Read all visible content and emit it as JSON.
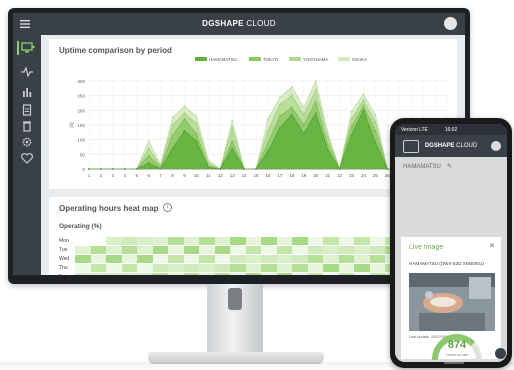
{
  "app": {
    "title_bold": "DGSHAPE",
    "title_rest": " CLOUD"
  },
  "sidebar": {
    "items": [
      "monitor-icon",
      "pulse-icon",
      "bar-chart-icon",
      "clipboard-icon",
      "trash-icon",
      "gear-icon",
      "heart-icon"
    ]
  },
  "uptime": {
    "title": "Uptime comparison by period",
    "ylabel": "[h]",
    "yticks": [
      "0",
      "50",
      "100",
      "150",
      "200",
      "250",
      "300"
    ],
    "xticks": [
      "1",
      "2",
      "3",
      "4",
      "5",
      "6",
      "7",
      "8",
      "9",
      "10",
      "11",
      "12",
      "13",
      "14",
      "15",
      "16",
      "17",
      "18",
      "19",
      "20",
      "21",
      "22",
      "23",
      "24",
      "25",
      "26",
      "27",
      "28",
      "29",
      "30",
      "31"
    ],
    "legend": [
      "HAMAMATSU",
      "TOKYO",
      "YOKOHAMA",
      "OSAKA"
    ]
  },
  "chart_data": {
    "type": "area",
    "x": [
      1,
      2,
      3,
      4,
      5,
      6,
      7,
      8,
      9,
      10,
      11,
      12,
      13,
      14,
      15,
      16,
      17,
      18,
      19,
      20,
      21,
      22,
      23,
      24,
      25,
      26,
      27,
      28,
      29,
      30,
      31
    ],
    "ylim": [
      0,
      300
    ],
    "ylabel": "[h]",
    "series": [
      {
        "name": "HAMAMATSU",
        "values": [
          0,
          0,
          0,
          0,
          0,
          20,
          0,
          70,
          130,
          95,
          5,
          0,
          70,
          0,
          0,
          60,
          140,
          185,
          120,
          190,
          65,
          0,
          115,
          200,
          90,
          0,
          0,
          0,
          0,
          0,
          0
        ]
      },
      {
        "name": "TOKYO",
        "values": [
          0,
          0,
          0,
          0,
          0,
          45,
          5,
          115,
          170,
          120,
          10,
          0,
          95,
          0,
          0,
          90,
          180,
          210,
          150,
          230,
          85,
          0,
          145,
          215,
          130,
          0,
          0,
          0,
          0,
          0,
          0
        ]
      },
      {
        "name": "YOKOHAMA",
        "values": [
          0,
          0,
          0,
          0,
          0,
          70,
          10,
          150,
          190,
          155,
          20,
          0,
          140,
          0,
          0,
          130,
          220,
          250,
          185,
          270,
          110,
          0,
          170,
          235,
          160,
          0,
          0,
          0,
          0,
          0,
          0
        ]
      },
      {
        "name": "OSAKA",
        "values": [
          0,
          0,
          0,
          0,
          0,
          95,
          15,
          175,
          215,
          180,
          30,
          0,
          165,
          0,
          0,
          170,
          245,
          280,
          210,
          300,
          125,
          0,
          195,
          255,
          185,
          0,
          0,
          0,
          0,
          0,
          0
        ]
      }
    ]
  },
  "heatmap": {
    "title": "Operating hours heat map",
    "subtitle": "Operating (%)",
    "rows": [
      "Mon",
      "Tue",
      "Wed",
      "Thu",
      "Fri"
    ]
  },
  "phone": {
    "status_left": "Verizon LTE",
    "time": "16:02",
    "location": "HAMAMATSU",
    "modal_title": "Live Image",
    "device": "HAMAMATSU (DWX-52D XM00001)",
    "last_update": "Last update: 2022/05/02 09:47:07",
    "gauge_value": "874",
    "gauge_label": "Hours of use"
  },
  "colors": {
    "accent": "#6ab04c",
    "dark": "#3a4048"
  }
}
